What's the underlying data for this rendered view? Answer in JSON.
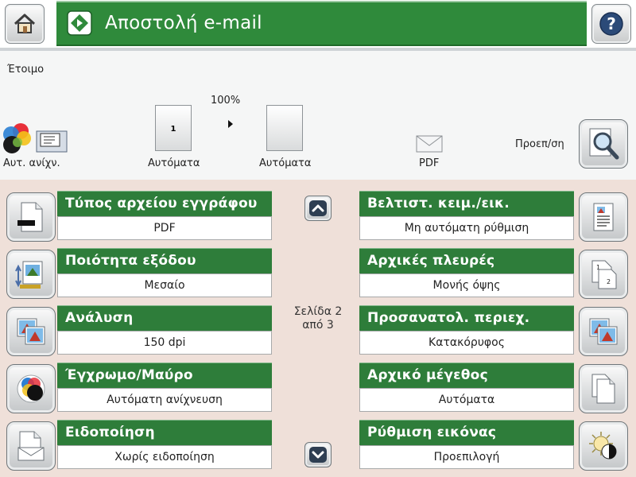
{
  "header": {
    "title": "Αποστολή e-mail",
    "home_icon": "home-icon",
    "help_icon": "help-icon",
    "title_icon": "start-icon",
    "accent_color": "#2f8a3b"
  },
  "status": {
    "text": "Έτοιμο",
    "zoom": "100%",
    "auto_detect_label": "Αυτ. ανίχν.",
    "page1_label": "Αυτόματα",
    "page1_number": "1",
    "page2_label": "Αυτόματα",
    "file_type_label": "PDF",
    "preview_label": "Προεπ/ση"
  },
  "options": {
    "left": [
      {
        "label": "Τύπος αρχείου εγγράφου",
        "value": "PDF",
        "icon": "file-type-icon"
      },
      {
        "label": "Ποιότητα εξόδου",
        "value": "Μεσαίο",
        "icon": "output-quality-icon"
      },
      {
        "label": "Ανάλυση",
        "value": "150 dpi",
        "icon": "resolution-icon"
      },
      {
        "label": "Έγχρωμο/Μαύρο",
        "value": "Αυτόματη ανίχνευση",
        "icon": "color-black-icon"
      },
      {
        "label": "Ειδοποίηση",
        "value": "Χωρίς ειδοποίηση",
        "icon": "notification-icon"
      }
    ],
    "right": [
      {
        "label": "Βελτιστ. κειμ./εικ.",
        "value": "Μη αυτόματη ρύθμιση",
        "icon": "optimize-text-picture-icon"
      },
      {
        "label": "Αρχικές πλευρές",
        "value": "Μονής όψης",
        "icon": "original-sides-icon"
      },
      {
        "label": "Προσανατολ. περιεχ.",
        "value": "Κατακόρυφος",
        "icon": "content-orientation-icon"
      },
      {
        "label": "Αρχικό μέγεθος",
        "value": "Αυτόματα",
        "icon": "original-size-icon"
      },
      {
        "label": "Ρύθμιση εικόνας",
        "value": "Προεπιλογή",
        "icon": "image-adjustment-icon"
      }
    ],
    "page_indicator_line1": "Σελίδα 2",
    "page_indicator_line2": "από 3"
  }
}
